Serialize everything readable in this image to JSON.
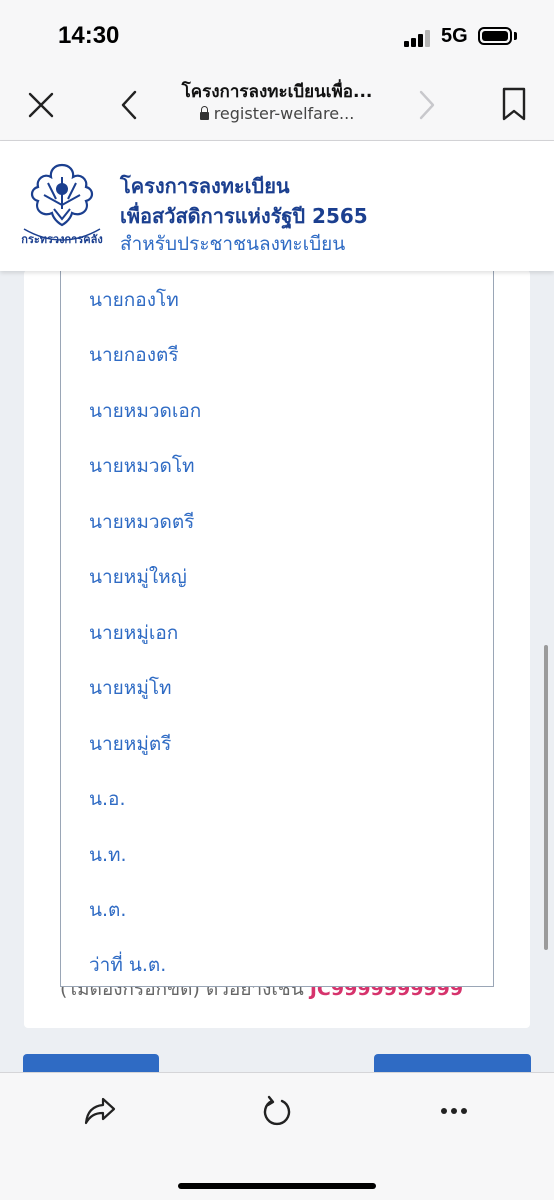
{
  "status_bar": {
    "time": "14:30",
    "network": "5G",
    "icons": [
      "signal-icon",
      "battery-icon"
    ]
  },
  "browser": {
    "page_title": "โครงการลงทะเบียนเพื่อ...",
    "url": "register-welfare...",
    "icons": [
      "close-icon",
      "back-icon",
      "forward-icon",
      "bookmark-icon",
      "lock-icon",
      "share-icon",
      "reload-icon",
      "more-icon"
    ]
  },
  "site": {
    "title_line1": "โครงการลงทะเบียน",
    "title_line2": "เพื่อสวัสดิการแห่งรัฐปี 2565",
    "subtitle": "สำหรับประชาชนลงทะเบียน",
    "logo_text": "กระทรวงการคลัง"
  },
  "dropdown": {
    "options": [
      "นายกองโท",
      "นายกองตรี",
      "นายหมวดเอก",
      "นายหมวดโท",
      "นายหมวดตรี",
      "นายหมู่ใหญ่",
      "นายหมู่เอก",
      "นายหมู่โท",
      "นายหมู่ตรี",
      "น.อ.",
      "น.ท.",
      "น.ต.",
      "ว่าที่ น.ต."
    ]
  },
  "form": {
    "hint_text": "(ไม่ต้องกรอกขีด) ตัวอย่างเช่น",
    "hint_code": "JC9999999999"
  },
  "colors": {
    "accent": "#2f6bc4",
    "title": "#1b3f8f",
    "hint_code": "#d6336c"
  }
}
